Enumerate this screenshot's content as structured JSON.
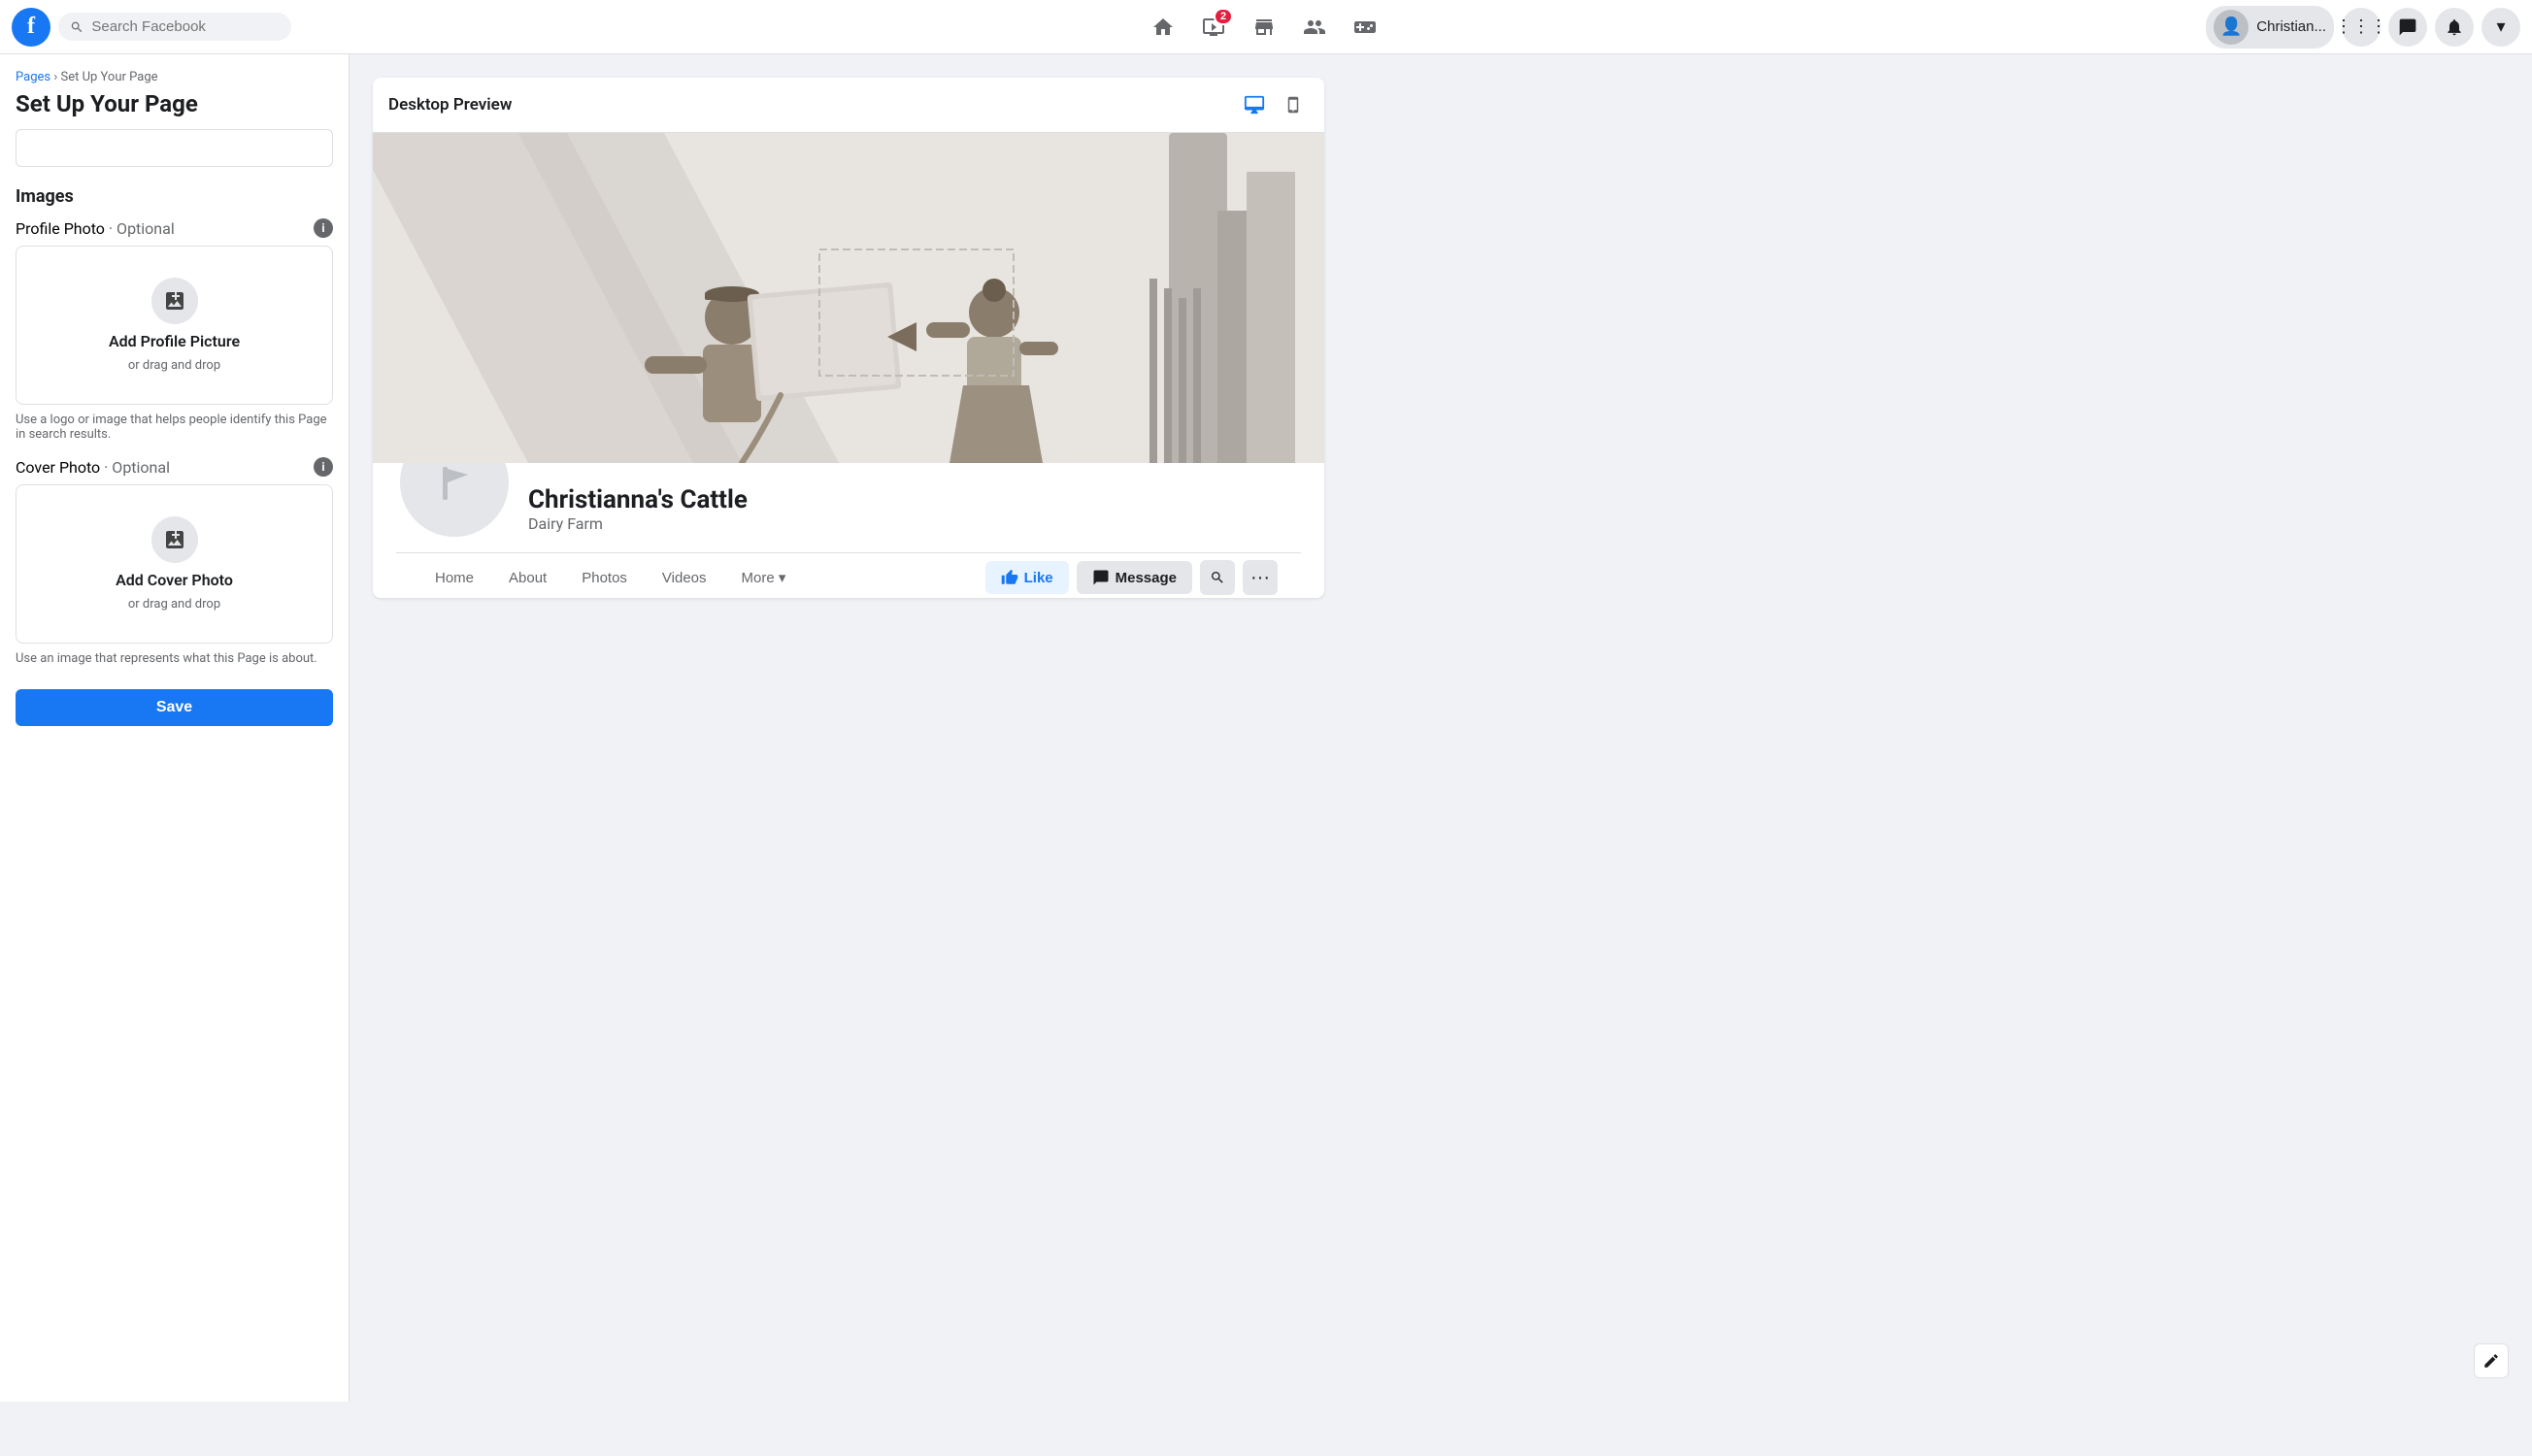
{
  "app": {
    "logo_letter": "f",
    "search_placeholder": "Search Facebook"
  },
  "nav": {
    "badge_count": "2",
    "user_name": "Christian...",
    "icons": [
      {
        "id": "home",
        "label": "Home"
      },
      {
        "id": "video",
        "label": "Watch"
      },
      {
        "id": "marketplace",
        "label": "Marketplace"
      },
      {
        "id": "groups",
        "label": "Groups"
      },
      {
        "id": "gaming",
        "label": "Gaming"
      }
    ]
  },
  "sidebar": {
    "breadcrumb_pages": "Pages",
    "breadcrumb_sep": " › ",
    "breadcrumb_current": "Set Up Your Page",
    "page_title": "Set Up Your Page",
    "name_placeholder": "",
    "images_title": "Images",
    "profile_photo_label": "Profile Photo",
    "profile_photo_optional": "· Optional",
    "profile_photo_btn_title": "Add Profile Picture",
    "profile_photo_btn_sub": "or drag and drop",
    "profile_hint": "Use a logo or image that helps people identify this Page in search results.",
    "cover_photo_label": "Cover Photo",
    "cover_photo_optional": "· Optional",
    "cover_photo_btn_title": "Add Cover Photo",
    "cover_photo_btn_sub": "or drag and drop",
    "cover_hint": "Use an image that represents what this Page is about.",
    "save_btn": "Save"
  },
  "preview": {
    "title": "Desktop Preview",
    "page_name": "Christianna's Cattle",
    "page_category": "Dairy Farm",
    "nav_tabs": [
      "Home",
      "About",
      "Photos",
      "Videos",
      "More ▾"
    ],
    "btn_like": "Like",
    "btn_message": "Message"
  }
}
